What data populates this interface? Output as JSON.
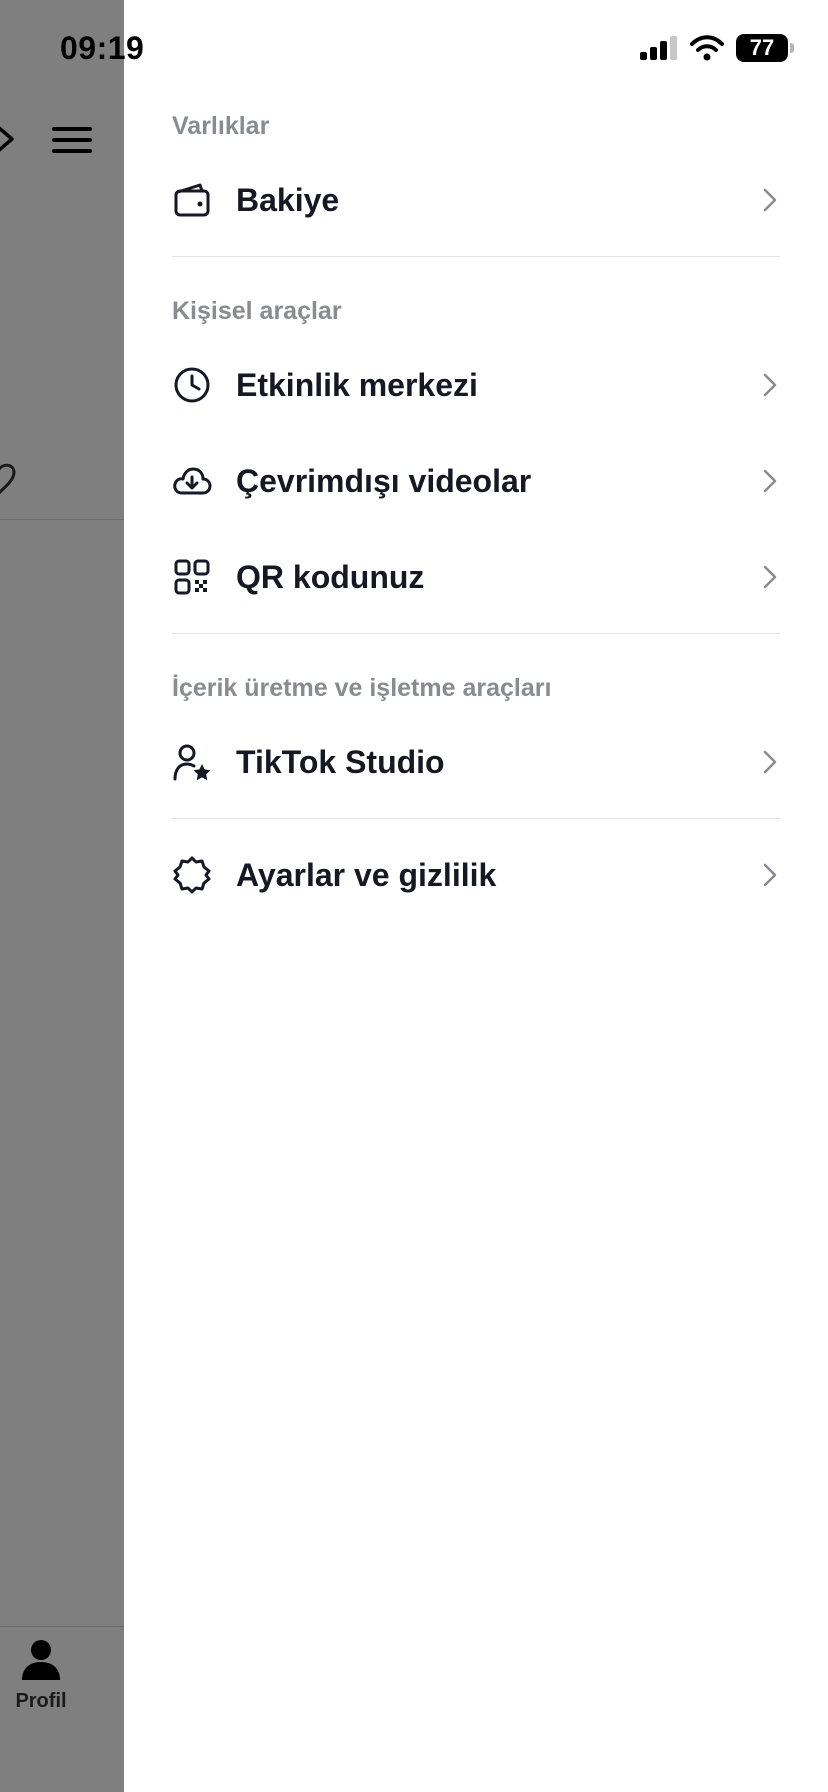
{
  "status_bar": {
    "time": "09:19",
    "battery_level": "77",
    "signal_icon": "cellular-signal-icon",
    "wifi_icon": "wifi-icon"
  },
  "background": {
    "profile_label": "Profil"
  },
  "drawer": {
    "sections": [
      {
        "title": "Varlıklar",
        "items": [
          {
            "label": "Bakiye",
            "icon": "wallet-icon"
          }
        ]
      },
      {
        "title": "Kişisel araçlar",
        "items": [
          {
            "label": "Etkinlik merkezi",
            "icon": "clock-icon"
          },
          {
            "label": "Çevrimdışı videolar",
            "icon": "cloud-download-icon"
          },
          {
            "label": "QR kodunuz",
            "icon": "qr-code-icon"
          }
        ]
      },
      {
        "title": "İçerik üretme ve işletme araçları",
        "items": [
          {
            "label": "TikTok Studio",
            "icon": "user-star-icon"
          }
        ]
      },
      {
        "title": "",
        "items": [
          {
            "label": "Ayarlar ve gizlilik",
            "icon": "gear-icon"
          }
        ]
      }
    ]
  }
}
